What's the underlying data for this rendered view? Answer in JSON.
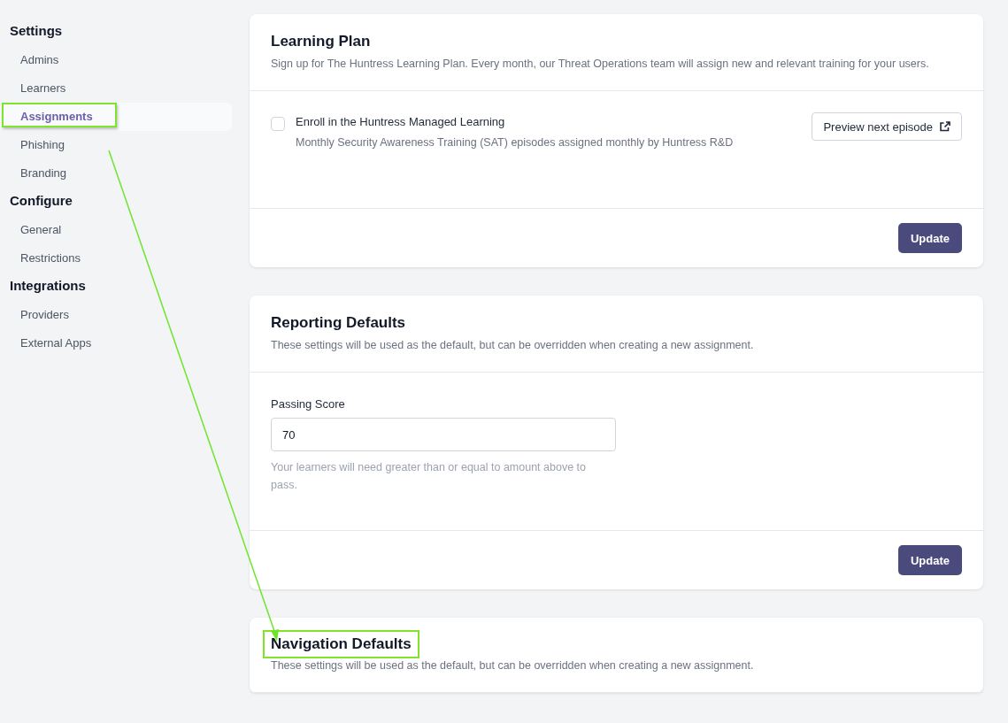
{
  "sidebar": {
    "groups": [
      {
        "heading": "Settings",
        "items": [
          {
            "label": "Admins",
            "selected": false,
            "highlighted": false
          },
          {
            "label": "Learners",
            "selected": false,
            "highlighted": false
          },
          {
            "label": "Assignments",
            "selected": true,
            "highlighted": true
          },
          {
            "label": "Phishing",
            "selected": false,
            "highlighted": false
          },
          {
            "label": "Branding",
            "selected": false,
            "highlighted": false
          }
        ]
      },
      {
        "heading": "Configure",
        "items": [
          {
            "label": "General",
            "selected": false,
            "highlighted": false
          },
          {
            "label": "Restrictions",
            "selected": false,
            "highlighted": false
          }
        ]
      },
      {
        "heading": "Integrations",
        "items": [
          {
            "label": "Providers",
            "selected": false,
            "highlighted": false
          },
          {
            "label": "External Apps",
            "selected": false,
            "highlighted": false
          }
        ]
      }
    ]
  },
  "cards": [
    {
      "kind": "checkbox",
      "title": "Learning Plan",
      "title_highlighted": false,
      "description": "Sign up for The Huntress Learning Plan. Every month, our Threat Operations team will assign new and relevant training for your users.",
      "option": {
        "label": "Enroll in the Huntress Managed Learning",
        "hint": "Monthly Security Awareness Training (SAT) episodes assigned monthly by Huntress R&D",
        "checked": false
      },
      "link_button": "Preview next episode",
      "footer_button": "Update"
    },
    {
      "kind": "field",
      "title": "Reporting Defaults",
      "title_highlighted": false,
      "description": "These settings will be used as the default, but can be overridden when creating a new assignment.",
      "field": {
        "label": "Passing Score",
        "value": "70",
        "hint": "Your learners will need greater than or equal to amount above to pass."
      },
      "footer_button": "Update"
    },
    {
      "kind": "header",
      "title": "Navigation Defaults",
      "title_highlighted": true,
      "description": "These settings will be used as the default, but can be overridden when creating a new assignment."
    }
  ]
}
